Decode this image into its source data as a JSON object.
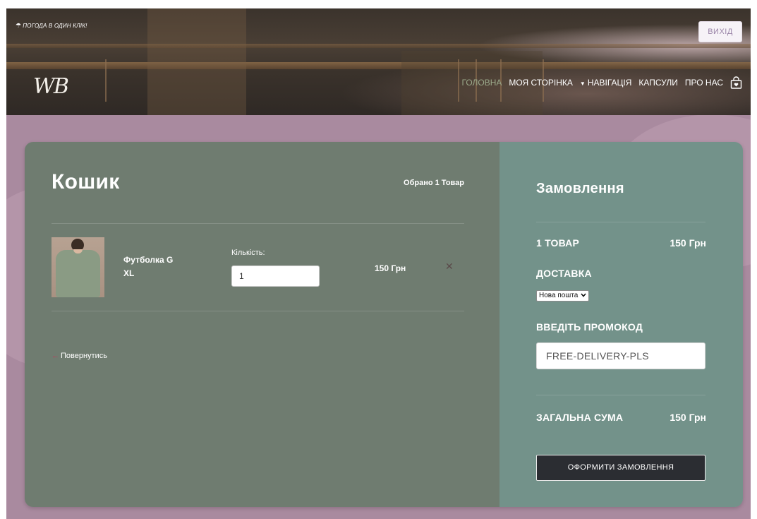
{
  "header": {
    "weather_link": "ПОГОДА В ОДИН КЛІК!",
    "logout_label": "ВИХІД",
    "logo_text": "WB",
    "nav": [
      {
        "label": "ГОЛОВНА",
        "active": true
      },
      {
        "label": "МОЯ СТОРІНКА",
        "active": false
      },
      {
        "label": "НАВІГАЦІЯ",
        "active": false,
        "dropdown": true
      },
      {
        "label": "КАПСУЛИ",
        "active": false
      },
      {
        "label": "ПРО НАС",
        "active": false
      }
    ],
    "cart_icon": "shopping-bag-icon"
  },
  "cart": {
    "title": "Кошик",
    "selected_count": "Обрано 1 Товар",
    "items": [
      {
        "name": "Футболка G",
        "size": "XL",
        "qty_label": "Кількість:",
        "qty_value": "1",
        "price": "150 Грн",
        "remove_icon": "close-icon"
      }
    ],
    "back_arrow": "←",
    "back_label": "Повернутись"
  },
  "order": {
    "title": "Замовлення",
    "items_label": "1 ТОВАР",
    "items_price": "150 Грн",
    "delivery_label": "ДОСТАВКА",
    "delivery_selected": "Нова пошта",
    "promo_label": "ВВЕДІТЬ ПРОМОКОД",
    "promo_value": "FREE-DELIVERY-PLS",
    "total_label": "ЗАГАЛЬНА СУМА",
    "total_value": "150 Грн",
    "checkout_label": "ОФОРМИТИ ЗАМОВЛЕННЯ"
  },
  "colors": {
    "left_panel": "#6f7c70",
    "right_panel": "#73928a",
    "page_bg": "#a98a9f",
    "active_nav": "#9aa88a",
    "checkout_btn": "#2b2d32"
  }
}
